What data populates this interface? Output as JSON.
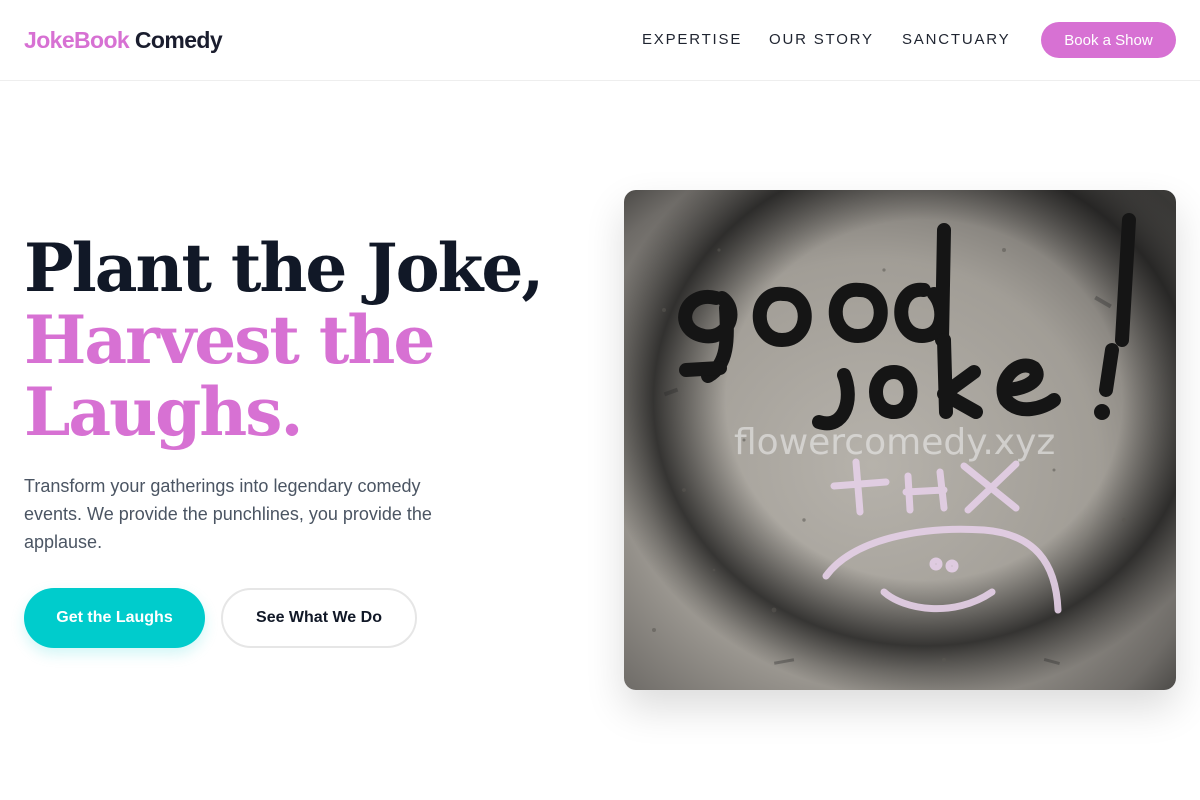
{
  "header": {
    "logo_brand": "JokeBook",
    "logo_rest": "Comedy",
    "nav": [
      "EXPERTISE",
      "OUR STORY",
      "SANCTUARY"
    ],
    "cta_label": "Book a Show"
  },
  "hero": {
    "headline_line1": "Plant the Joke,",
    "headline_line2": "Harvest the",
    "headline_line3": "Laughs.",
    "subtitle": "Transform your gatherings into legendary comedy events. We provide the punchlines, you provide the applause.",
    "primary_button": "Get the Laughs",
    "secondary_button": "See What We Do",
    "image_watermark": "flowercomedy.xyz"
  },
  "colors": {
    "accent": "#d771d3",
    "primary_button": "#00cccc",
    "text_dark": "#111827",
    "text_muted": "#4b5563"
  }
}
